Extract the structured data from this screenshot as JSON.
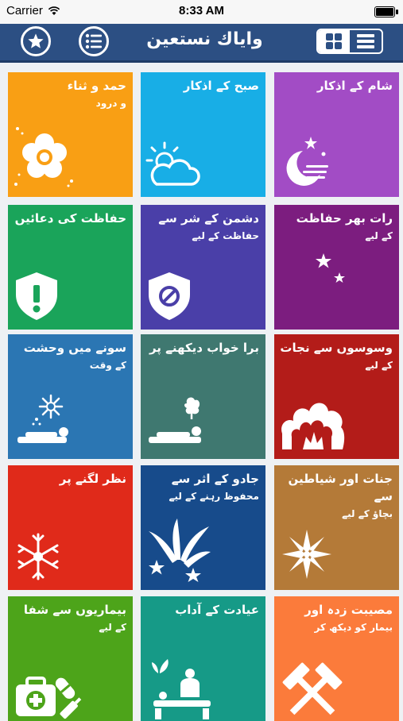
{
  "status_bar": {
    "carrier": "Carrier",
    "time": "8:33 AM"
  },
  "navbar": {
    "title": "واياك نستعين",
    "star_icon": "star-icon",
    "list_icon": "list-icon",
    "grid_view_icon": "grid-icon",
    "list_view_icon": "list-lines-icon"
  },
  "colors": {
    "nav": "#2c4f83",
    "tiles": [
      "#f99f14",
      "#18aee6",
      "#a24cc5",
      "#1aa45a",
      "#4a3fa8",
      "#7c1d7f",
      "#2b76b3",
      "#3f7870",
      "#b31c19",
      "#e02a1a",
      "#174b8b",
      "#b47a38",
      "#4da41a",
      "#169a87",
      "#fb7b3b"
    ]
  },
  "tiles": [
    {
      "line1": "حمد و ثناء",
      "line2": "و درود",
      "icon": "flower-icon"
    },
    {
      "line1": "صبح کے اذکار",
      "line2": "",
      "icon": "sun-cloud-icon"
    },
    {
      "line1": "شام کے اذکار",
      "line2": "",
      "icon": "moon-stars-icon"
    },
    {
      "line1": "حفاظت کی دعائیں",
      "line2": "",
      "icon": "shield-alert-icon"
    },
    {
      "line1": "دشمن کے شر سے",
      "line2": "حفاظت کے لیے",
      "icon": "shield-block-icon"
    },
    {
      "line1": "رات بھر حفاظت",
      "line2": "کے لیے",
      "icon": "crescent-icon"
    },
    {
      "line1": "سونے میں وحشت",
      "line2": "کے وقت",
      "icon": "sleep-fright-icon"
    },
    {
      "line1": "برا خواب دیکھنے پر",
      "line2": "",
      "icon": "bad-dream-icon"
    },
    {
      "line1": "وسوسوں سے نجات",
      "line2": "کے لیے",
      "icon": "explosion-icon"
    },
    {
      "line1": "نظر لگنے پر",
      "line2": "",
      "icon": "snowflake-icon"
    },
    {
      "line1": "جادو کے اثر سے",
      "line2": "محفوظ رہنے کے لیے",
      "icon": "magic-burst-icon"
    },
    {
      "line1": "جنات اور شیاطین سے",
      "line2": "بچاؤ کے لیے",
      "icon": "sparkle-flower-icon"
    },
    {
      "line1": "بیماریوں سے شفا",
      "line2": "کے لیے",
      "icon": "medical-kit-icon"
    },
    {
      "line1": "عیادت کے آداب",
      "line2": "",
      "icon": "patient-care-icon"
    },
    {
      "line1": "مصیبت زدہ اور",
      "line2": "بیمار کو دیکھ کر",
      "icon": "hammers-icon"
    }
  ]
}
